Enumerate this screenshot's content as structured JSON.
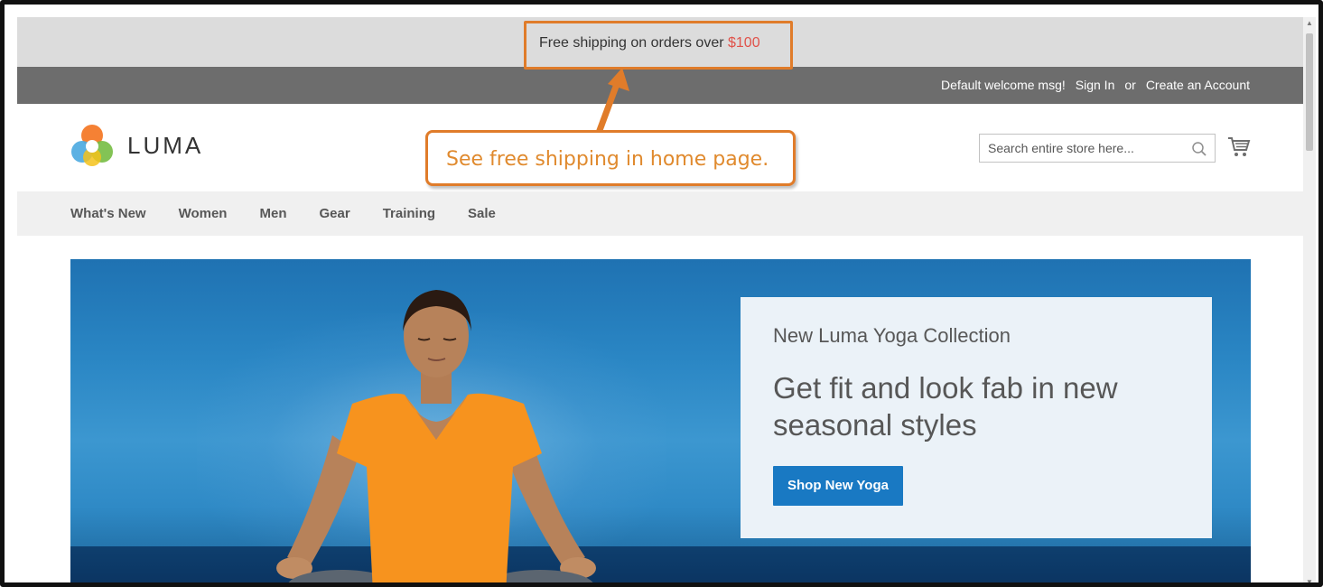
{
  "promo": {
    "text_before": "Free shipping on orders over ",
    "amount": "$100"
  },
  "panel_header": {
    "welcome": "Default welcome msg!",
    "sign_in": "Sign In",
    "or": "or",
    "create_account": "Create an Account"
  },
  "logo": {
    "text": "LUMA"
  },
  "search": {
    "placeholder": "Search entire store here...",
    "icon": "search-icon"
  },
  "cart": {
    "icon": "cart-icon"
  },
  "nav": {
    "items": [
      {
        "label": "What's New"
      },
      {
        "label": "Women"
      },
      {
        "label": "Men"
      },
      {
        "label": "Gear"
      },
      {
        "label": "Training"
      },
      {
        "label": "Sale"
      }
    ]
  },
  "hero": {
    "subtitle": "New Luma Yoga Collection",
    "title": "Get fit and look fab in new seasonal styles",
    "button_label": "Shop New Yoga"
  },
  "annotation": {
    "callout_text": "See free shipping in home page.",
    "color": "#e07c2a"
  },
  "colors": {
    "promo_amount": "#e0524a",
    "primary_button": "#1979c3",
    "header_bar": "#6d6d6d"
  }
}
